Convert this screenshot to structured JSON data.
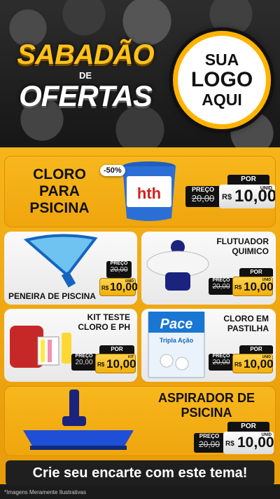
{
  "header": {
    "title_line1": "SABADÃO",
    "title_line2": "DE",
    "title_line3": "OFERTAS",
    "logo_line1": "SUA",
    "logo_line2": "LOGO",
    "logo_line3": "AQUI"
  },
  "products": {
    "cloro": {
      "name": "CLORO PARA PSICINA",
      "discount": "-50%",
      "por_label": "POR",
      "preco_label": "PREÇO",
      "old_price": "20,00",
      "currency": "R$",
      "price": "10,00",
      "unit": "UNID"
    },
    "peneira": {
      "name": "PENEIRA DE PISCINA",
      "preco_label": "PREÇO",
      "old_price": "20,00",
      "currency": "R$",
      "price": "10,00",
      "unit": "UNID"
    },
    "flutuador": {
      "name": "FLUTUADOR QUIMICO",
      "por_label": "POR",
      "preco_label": "PREÇO",
      "old_price": "20,00",
      "currency": "R$",
      "price": "10,00",
      "unit": "UNID"
    },
    "kit": {
      "name": "KIT TESTE CLORO E PH",
      "por_label": "POR",
      "preco_label": "PREÇO",
      "old_price": "20,00",
      "currency": "R$",
      "price": "10,00",
      "unit": "KIT"
    },
    "pastilha": {
      "name": "CLORO EM PASTILHA",
      "por_label": "POR",
      "preco_label": "PREÇO",
      "old_price": "20,00",
      "currency": "R$",
      "price": "10,00",
      "unit": "UNID",
      "pack_brand": "Pace",
      "pack_line1": "Tripla Ação"
    },
    "aspirador": {
      "name": "ASPIRADOR DE PSICINA",
      "por_label": "POR",
      "preco_label": "PREÇO",
      "old_price": "20,00",
      "currency": "R$",
      "price": "10,00",
      "unit": "UNID"
    },
    "bucket_brand": "hth"
  },
  "footer": {
    "cta": "Crie seu encarte com este tema!",
    "disclaimer": "*Imagens Meramente Ilustrativas"
  },
  "colors": {
    "accent": "#f6b41a",
    "dark": "#111111"
  }
}
